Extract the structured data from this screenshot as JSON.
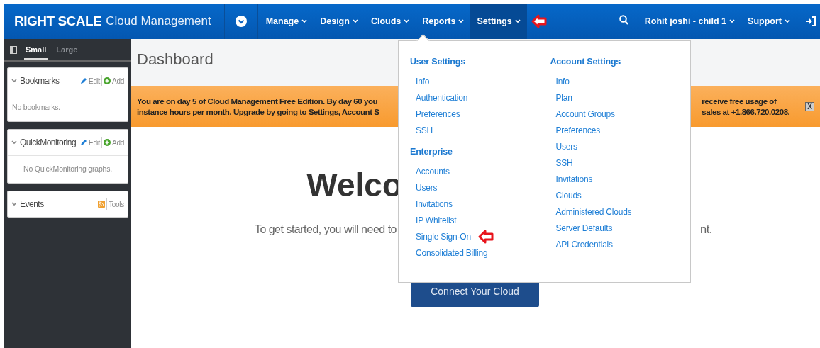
{
  "nav": {
    "logo": "RIGHT SCALE",
    "product": "Cloud Management",
    "menus": [
      {
        "label": "Manage",
        "selected": false,
        "annotated": false
      },
      {
        "label": "Design",
        "selected": false,
        "annotated": false
      },
      {
        "label": "Clouds",
        "selected": false,
        "annotated": false
      },
      {
        "label": "Reports",
        "selected": false,
        "annotated": false
      },
      {
        "label": "Settings",
        "selected": true,
        "annotated": true
      }
    ],
    "user": "Rohit joshi - child 1",
    "support": "Support"
  },
  "sidebar": {
    "tabs": [
      {
        "label": "Small",
        "selected": true
      },
      {
        "label": "Large",
        "selected": false
      }
    ],
    "panels": [
      {
        "title": "Bookmarks",
        "actions": [
          {
            "kind": "edit",
            "label": "Edit"
          },
          {
            "kind": "add",
            "label": "Add"
          }
        ],
        "body": "No bookmarks.",
        "centered": false
      },
      {
        "title": "QuickMonitoring",
        "actions": [
          {
            "kind": "edit",
            "label": "Edit"
          },
          {
            "kind": "add",
            "label": "Add"
          }
        ],
        "body": "No QuickMonitoring graphs.",
        "centered": true
      },
      {
        "title": "Events",
        "actions": [
          {
            "kind": "rss"
          },
          {
            "kind": "text",
            "label": "Tools"
          }
        ]
      }
    ]
  },
  "main": {
    "title": "Dashboard",
    "banner": {
      "left_lines": [
        "You are on day 5 of Cloud Management Free Edition. By day 60 you",
        "instance hours per month. Upgrade by going to Settings, Account S"
      ],
      "right_lines": [
        "receive free usage of",
        "sales at +1.866.720.0208."
      ],
      "close_label": "X"
    },
    "welcome": {
      "heading": "Welco",
      "subtitle": "To get started, you will need to",
      "subtitle_end": "nt.",
      "button": "Connect Your Cloud"
    }
  },
  "dropdown": {
    "columns": [
      {
        "groups": [
          {
            "heading": "User Settings",
            "items": [
              {
                "label": "Info",
                "annotated": false
              },
              {
                "label": "Authentication",
                "annotated": false
              },
              {
                "label": "Preferences",
                "annotated": false
              },
              {
                "label": "SSH",
                "annotated": false
              }
            ]
          },
          {
            "heading": "Enterprise",
            "items": [
              {
                "label": "Accounts",
                "annotated": false
              },
              {
                "label": "Users",
                "annotated": false
              },
              {
                "label": "Invitations",
                "annotated": false
              },
              {
                "label": "IP Whitelist",
                "annotated": false
              },
              {
                "label": "Single Sign-On",
                "annotated": true
              },
              {
                "label": "Consolidated Billing",
                "annotated": false
              }
            ]
          }
        ]
      },
      {
        "groups": [
          {
            "heading": "Account Settings",
            "items": [
              {
                "label": "Info",
                "annotated": false
              },
              {
                "label": "Plan",
                "annotated": false
              },
              {
                "label": "Account Groups",
                "annotated": false
              },
              {
                "label": "Preferences",
                "annotated": false
              },
              {
                "label": "Users",
                "annotated": false
              },
              {
                "label": "SSH",
                "annotated": false
              },
              {
                "label": "Invitations",
                "annotated": false
              },
              {
                "label": "Clouds",
                "annotated": false
              },
              {
                "label": "Administered Clouds",
                "annotated": false
              },
              {
                "label": "Server Defaults",
                "annotated": false
              },
              {
                "label": "API Credentials",
                "annotated": false
              }
            ]
          }
        ]
      }
    ]
  }
}
